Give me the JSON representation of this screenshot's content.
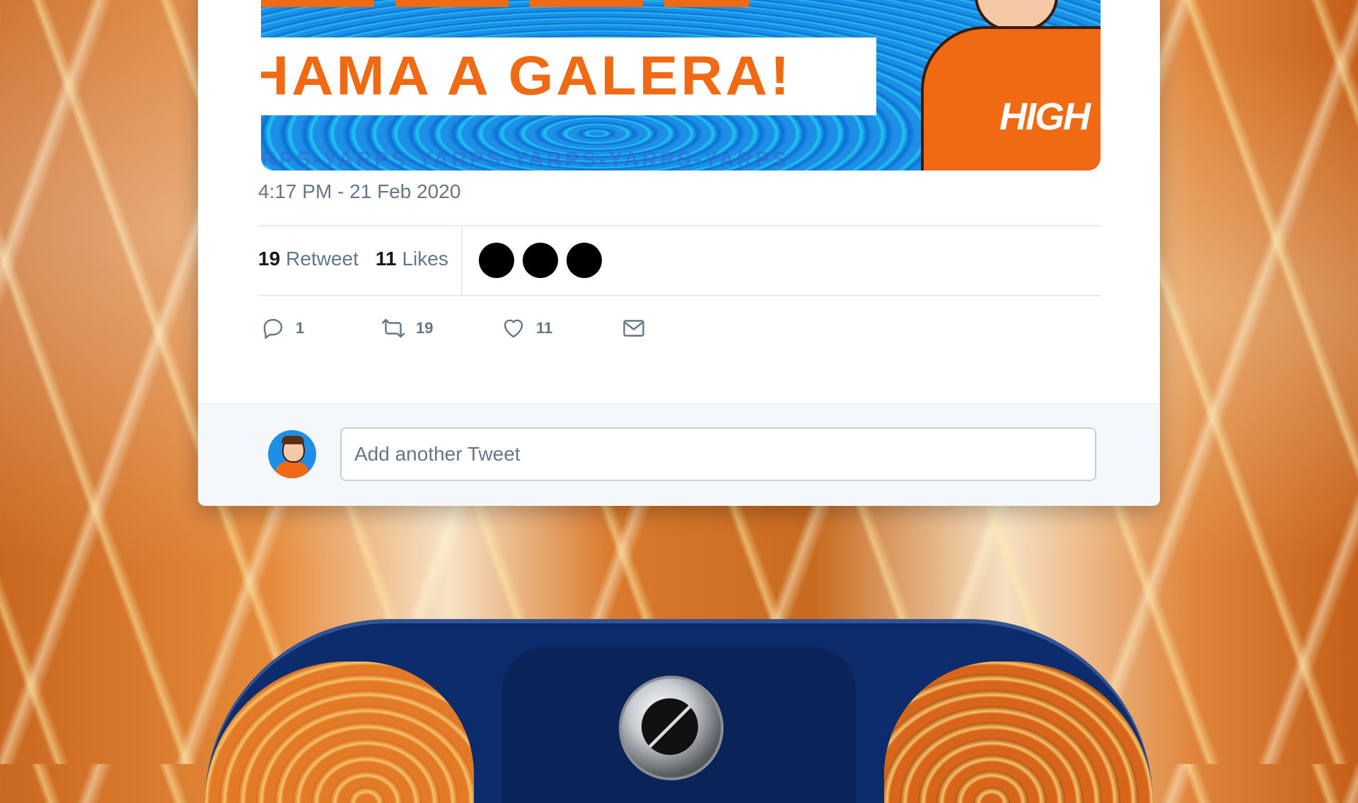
{
  "tweet": {
    "media": {
      "banner_text": "HAMA A GALERA!",
      "brand_text": "HIGH",
      "strip_text": "RPS-YARPS-YARPS-YARPS-YARPS-YARPS"
    },
    "timestamp": "4:17 PM - 21 Feb 2020",
    "stats": {
      "retweet_count": "19",
      "retweet_label": "Retweet",
      "likes_count": "11",
      "likes_label": "Likes"
    },
    "actions": {
      "reply_count": "1",
      "retweet_count": "19",
      "like_count": "11"
    },
    "reply": {
      "placeholder": "Add another Tweet"
    },
    "icons": {
      "reply": "reply-icon",
      "retweet": "retweet-icon",
      "like": "heart-icon",
      "message": "mail-icon"
    }
  },
  "colors": {
    "accent_orange": "#f06a14",
    "media_blue": "#1d8fe6",
    "text_secondary": "#657786",
    "text_primary": "#14171a",
    "controller_navy": "#0d2c6b"
  }
}
